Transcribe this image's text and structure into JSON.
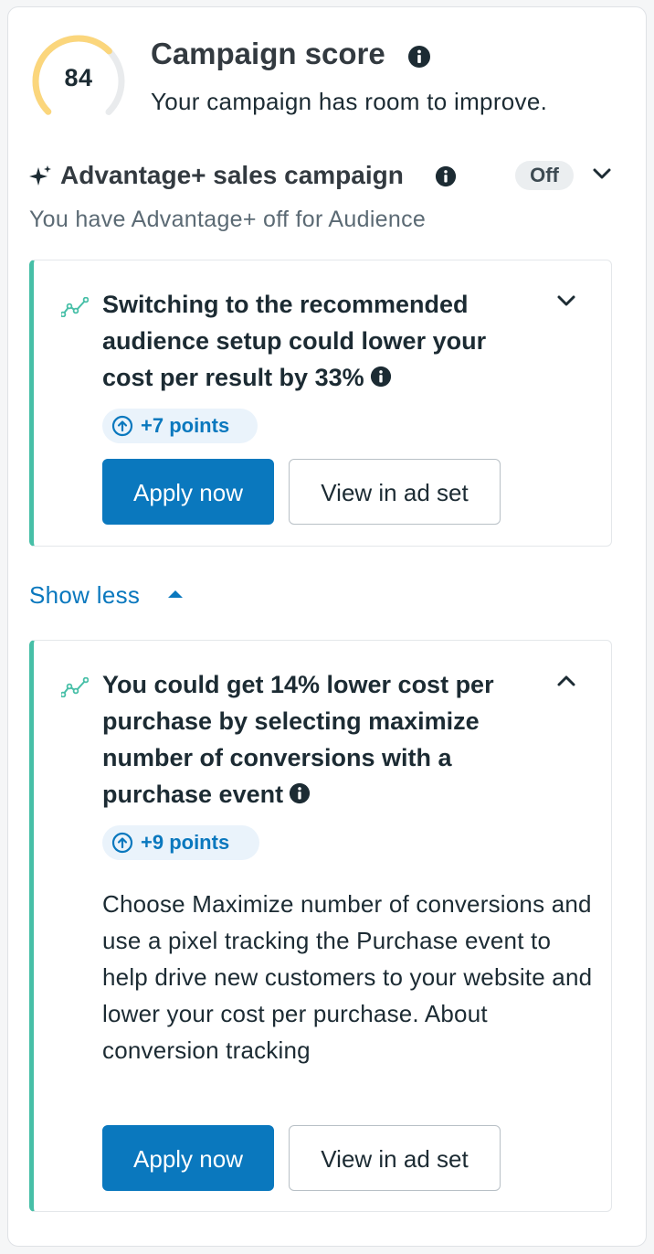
{
  "score": {
    "value": "84",
    "value_fraction": 0.84,
    "title": "Campaign score",
    "subtitle": "Your campaign has room to improve.",
    "gauge_color": "#fbd67c",
    "track_color": "#e9ebed"
  },
  "advantage": {
    "title": "Advantage+ sales campaign",
    "status": "Off",
    "subtitle": "You have Advantage+ off for Audience"
  },
  "recommendations": [
    {
      "title": "Switching to the recommended audience setup could lower your cost per result by 33%",
      "points": "+7 points",
      "primary_label": "Apply now",
      "secondary_label": "View in ad set",
      "expanded": false
    },
    {
      "title": "You could get 14% lower cost per purchase by selecting maximize number of conversions with a purchase event",
      "points": "+9 points",
      "body": "Choose Maximize number of conversions and use a pixel tracking the Purchase event to help drive new customers to your website and lower your cost per purchase. About conversion tracking",
      "primary_label": "Apply now",
      "secondary_label": "View in ad set",
      "expanded": true
    }
  ],
  "show_less_label": "Show less",
  "colors": {
    "accent": "#0a78be",
    "card_stripe": "#47bfa7",
    "badge_bg": "#eaf3fb"
  },
  "icons": {
    "info": "info-icon",
    "sparkle": "sparkle-icon",
    "trend": "trend-icon",
    "chevron_down": "chevron-down-icon",
    "chevron_up": "chevron-up-icon",
    "arrow_up_circle": "arrow-up-circle-icon",
    "caret_up": "caret-up-icon"
  }
}
